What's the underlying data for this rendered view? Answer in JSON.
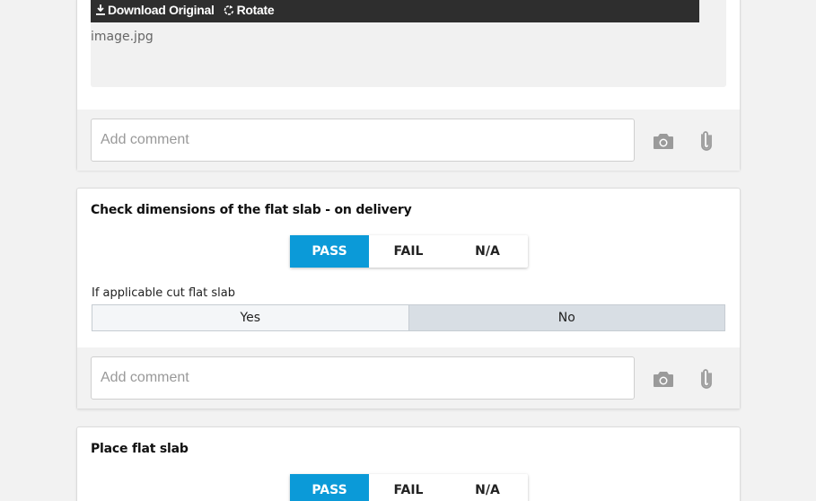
{
  "image_attachment": {
    "download_label": "Download Original",
    "rotate_label": "Rotate",
    "filename": "image.jpg"
  },
  "comment": {
    "placeholder": "Add comment"
  },
  "items": [
    {
      "title": "Check dimensions of the flat slab - on delivery",
      "options": [
        "PASS",
        "FAIL",
        "N/A"
      ],
      "selected": "PASS",
      "sub_question": {
        "label": "If applicable cut flat slab",
        "yes_label": "Yes",
        "no_label": "No",
        "selected": "No"
      }
    },
    {
      "title": "Place flat slab",
      "options": [
        "PASS",
        "FAIL",
        "N/A"
      ],
      "selected": "PASS"
    }
  ],
  "colors": {
    "accent": "#0b9ad8",
    "selected_toggle": "#d8dee4",
    "toolbar": "#2e2e2e"
  },
  "icons": [
    "download-icon",
    "rotate-icon",
    "camera-icon",
    "paperclip-icon"
  ]
}
